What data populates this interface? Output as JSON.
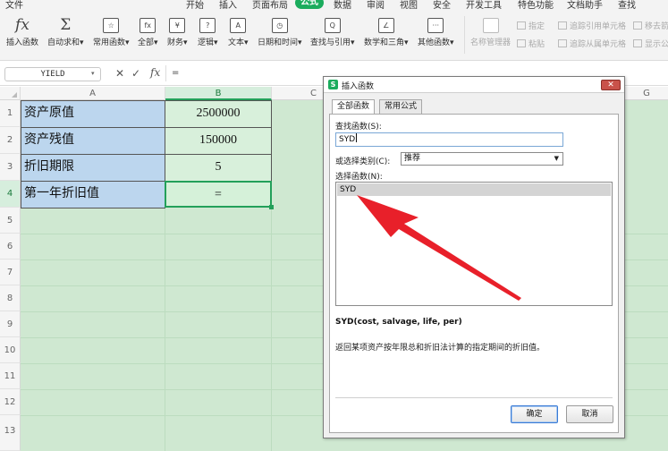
{
  "menubar": {
    "items": [
      "文件",
      "开始",
      "插入",
      "页面布局",
      "公式",
      "数据",
      "审阅",
      "视图",
      "安全",
      "开发工具",
      "特色功能",
      "文档助手",
      "查找"
    ],
    "active": "公式"
  },
  "ribbon": {
    "buttons": [
      {
        "label": "插入函数",
        "icon": "fx"
      },
      {
        "label": "自动求和",
        "icon": "Σ"
      },
      {
        "label": "常用函数",
        "icon": "☆"
      },
      {
        "label": "全部",
        "icon": "fx"
      },
      {
        "label": "财务",
        "icon": "¥"
      },
      {
        "label": "逻辑",
        "icon": "?"
      },
      {
        "label": "文本",
        "icon": "A"
      },
      {
        "label": "日期和时间",
        "icon": "◷"
      },
      {
        "label": "查找与引用",
        "icon": "Q"
      },
      {
        "label": "数学和三角",
        "icon": "∠"
      },
      {
        "label": "其他函数",
        "icon": "···"
      }
    ],
    "disabled": {
      "name_manager": "名称管理器",
      "specify": "指定",
      "paste": "粘贴",
      "trace_precedents": "追踪引用单元格",
      "trace_dependents": "追踪从属单元格",
      "remove_arrows": "移去箭",
      "show_formulas": "显示公"
    }
  },
  "formula_bar": {
    "name_box": "YIELD",
    "cancel_icon": "✕",
    "enter_icon": "✓",
    "fx": "fx",
    "value": "="
  },
  "columns": [
    "A",
    "B",
    "C",
    "G"
  ],
  "rows": [
    "1",
    "2",
    "3",
    "4",
    "5",
    "6",
    "7",
    "8",
    "9",
    "10",
    "11",
    "12",
    "13"
  ],
  "cells": [
    {
      "label": "资产原值",
      "value": "2500000"
    },
    {
      "label": "资产残值",
      "value": "150000"
    },
    {
      "label": "折旧期限",
      "value": "5"
    },
    {
      "label": "第一年折旧值",
      "value": "="
    }
  ],
  "dialog": {
    "title": "插入函数",
    "close": "✕",
    "tabs": [
      "全部函数",
      "常用公式"
    ],
    "search_label": "查找函数(S):",
    "search_value": "SYD",
    "category_label": "或选择类别(C):",
    "category_value": "推荐",
    "select_label": "选择函数(N):",
    "functions": [
      "SYD"
    ],
    "signature": "SYD(cost, salvage, life, per)",
    "description": "返回某项资产按年限总和折旧法计算的指定期间的折旧值。",
    "ok": "确定",
    "cancel": "取消"
  },
  "colors": {
    "accent": "#1bac5d",
    "grid": "#cfe8d1",
    "label_cell": "#bcd6ee",
    "arrow": "#e8202a"
  }
}
